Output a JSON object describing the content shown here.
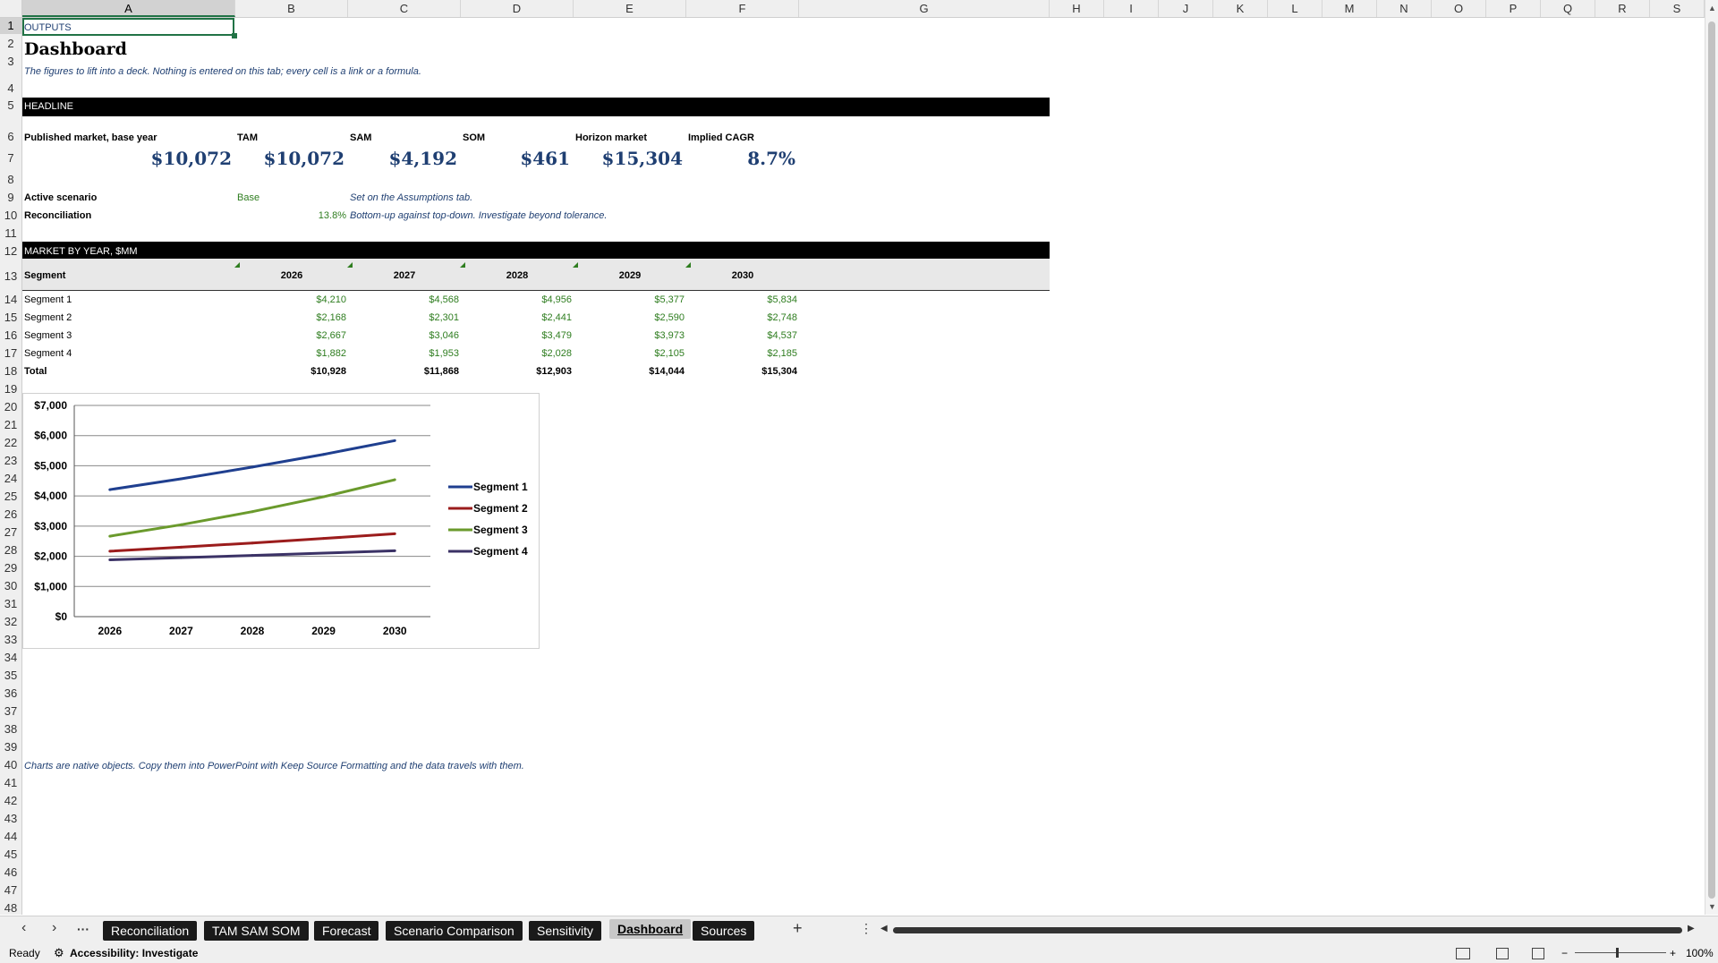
{
  "columns": [
    "A",
    "B",
    "C",
    "D",
    "E",
    "F",
    "G",
    "H",
    "I",
    "J",
    "K",
    "L",
    "M",
    "N",
    "O",
    "P",
    "Q",
    "R",
    "S"
  ],
  "rows": [
    "1",
    "2",
    "3",
    "4",
    "5",
    "6",
    "7",
    "8",
    "9",
    "10",
    "11",
    "12",
    "13",
    "14",
    "15",
    "16",
    "17",
    "18",
    "19",
    "20",
    "21",
    "22",
    "23",
    "24",
    "25",
    "26",
    "27",
    "28",
    "29",
    "30",
    "31",
    "32",
    "33",
    "34",
    "35",
    "36",
    "37",
    "38",
    "39",
    "40",
    "41",
    "42",
    "43",
    "44",
    "45",
    "46",
    "47",
    "48"
  ],
  "sheet": {
    "outputs_label": "OUTPUTS",
    "title": "Dashboard",
    "subtitle": "The figures to lift into a deck. Nothing is entered on this tab; every cell is a link or a formula.",
    "headline_band": "HEADLINE",
    "headline_labels": [
      "Published market, base year",
      "TAM",
      "SAM",
      "SOM",
      "Horizon market",
      "Implied CAGR"
    ],
    "headline_values": [
      "$10,072",
      "$10,072",
      "$4,192",
      "$461",
      "$15,304",
      "8.7%"
    ],
    "active_scenario_label": "Active scenario",
    "active_scenario_value": "Base",
    "active_scenario_note": "Set on the Assumptions tab.",
    "reconciliation_label": "Reconciliation",
    "reconciliation_value": "13.8%",
    "reconciliation_note": "Bottom-up against top-down. Investigate beyond tolerance.",
    "market_band": "MARKET BY YEAR, $MM",
    "table_header": [
      "Segment",
      "2026",
      "2027",
      "2028",
      "2029",
      "2030"
    ],
    "table_rows": [
      {
        "name": "Segment 1",
        "values": [
          "$4,210",
          "$4,568",
          "$4,956",
          "$5,377",
          "$5,834"
        ]
      },
      {
        "name": "Segment 2",
        "values": [
          "$2,168",
          "$2,301",
          "$2,441",
          "$2,590",
          "$2,748"
        ]
      },
      {
        "name": "Segment 3",
        "values": [
          "$2,667",
          "$3,046",
          "$3,479",
          "$3,973",
          "$4,537"
        ]
      },
      {
        "name": "Segment 4",
        "values": [
          "$1,882",
          "$1,953",
          "$2,028",
          "$2,105",
          "$2,185"
        ]
      }
    ],
    "total_row": {
      "name": "Total",
      "values": [
        "$10,928",
        "$11,868",
        "$12,903",
        "$14,044",
        "$15,304"
      ]
    },
    "footnote": "Charts are native objects. Copy them into PowerPoint with Keep Source Formatting and the data travels with them."
  },
  "chart_data": {
    "type": "line",
    "x": [
      "2026",
      "2027",
      "2028",
      "2029",
      "2030"
    ],
    "ylim": [
      0,
      7000
    ],
    "yticks": [
      "$0",
      "$1,000",
      "$2,000",
      "$3,000",
      "$4,000",
      "$5,000",
      "$6,000",
      "$7,000"
    ],
    "grid": true,
    "legend": "right",
    "series": [
      {
        "name": "Segment 1",
        "values": [
          4210,
          4568,
          4956,
          5377,
          5834
        ],
        "color": "#1f3f8f"
      },
      {
        "name": "Segment 2",
        "values": [
          2168,
          2301,
          2441,
          2590,
          2748
        ],
        "color": "#9b1c1c"
      },
      {
        "name": "Segment 3",
        "values": [
          2667,
          3046,
          3479,
          3973,
          4537
        ],
        "color": "#6a9a2c"
      },
      {
        "name": "Segment 4",
        "values": [
          1882,
          1953,
          2028,
          2105,
          2185
        ],
        "color": "#3b3266"
      }
    ]
  },
  "tabs": {
    "items": [
      "Reconciliation",
      "TAM SAM SOM",
      "Forecast",
      "Scenario Comparison",
      "Sensitivity",
      "Dashboard",
      "Sources"
    ],
    "active": "Dashboard",
    "more": "···",
    "add": "+"
  },
  "status": {
    "ready": "Ready",
    "accessibility": "Accessibility: Investigate",
    "zoom": "100%"
  },
  "icons": [
    "prev-sheet-icon",
    "next-sheet-icon",
    "accessibility-icon",
    "normal-view-icon",
    "page-layout-icon",
    "page-break-icon",
    "zoom-out-icon",
    "zoom-in-icon"
  ]
}
